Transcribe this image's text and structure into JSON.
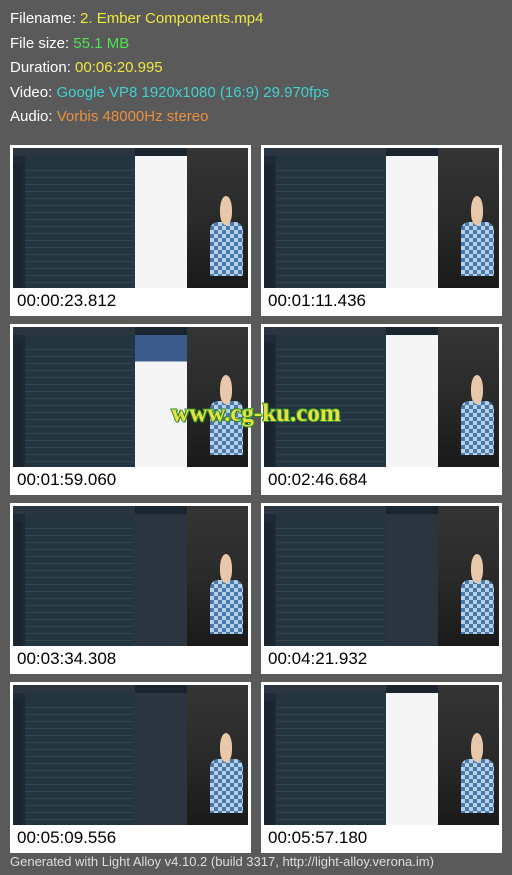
{
  "meta": {
    "filename_label": "Filename: ",
    "filename_value": "2. Ember Components.mp4",
    "filesize_label": "File size: ",
    "filesize_value": "55.1 MB",
    "duration_label": "Duration: ",
    "duration_value": "00:06:20.995",
    "video_label": "Video: ",
    "video_value": "Google VP8 1920x1080 (16:9) 29.970fps",
    "audio_label": "Audio: ",
    "audio_value": "Vorbis 48000Hz stereo"
  },
  "thumbs": [
    {
      "time": "00:00:23.812"
    },
    {
      "time": "00:01:11.436"
    },
    {
      "time": "00:01:59.060"
    },
    {
      "time": "00:02:46.684"
    },
    {
      "time": "00:03:34.308"
    },
    {
      "time": "00:04:21.932"
    },
    {
      "time": "00:05:09.556"
    },
    {
      "time": "00:05:57.180"
    }
  ],
  "watermark": "www.cg-ku.com",
  "footer": "Generated with Light Alloy v4.10.2 (build 3317, http://light-alloy.verona.im)"
}
